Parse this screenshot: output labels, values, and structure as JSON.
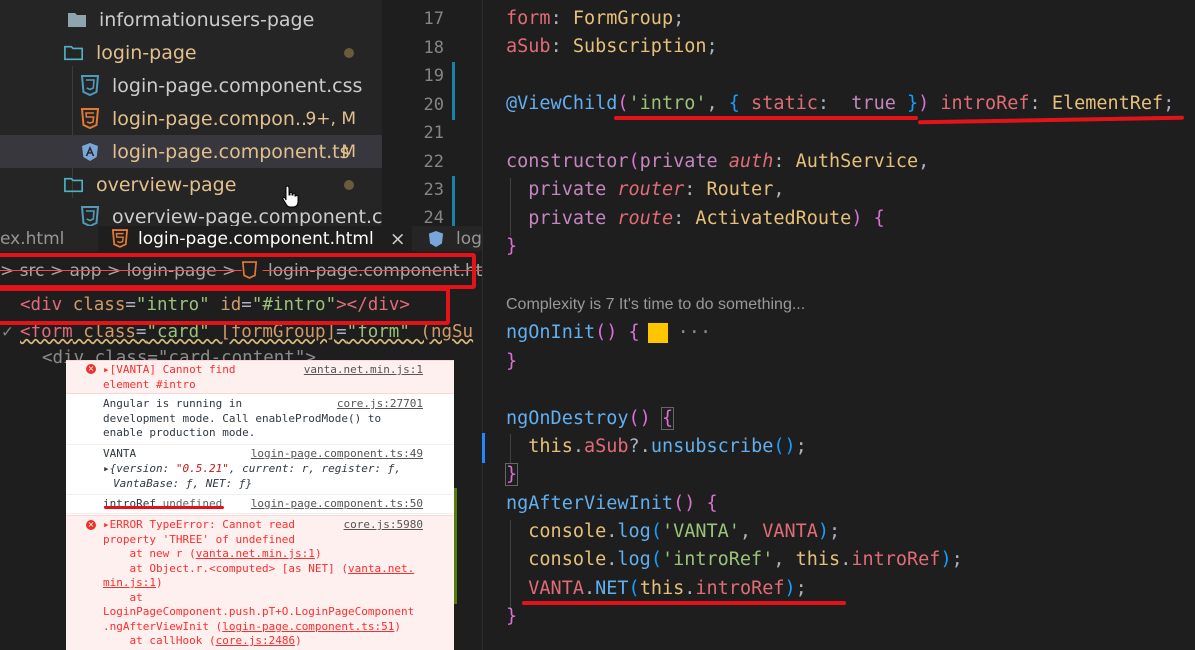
{
  "explorer": {
    "items": [
      {
        "label": "informationusers-page",
        "type": "folder-closed",
        "status": ""
      },
      {
        "label": "login-page",
        "type": "folder-open",
        "status": "dot"
      },
      {
        "label": "login-page.component.css",
        "type": "css",
        "status": ""
      },
      {
        "label": "login-page.compon...",
        "type": "html",
        "status": "9+, M"
      },
      {
        "label": "login-page.component.ts",
        "type": "ts",
        "status": "M"
      },
      {
        "label": "overview-page",
        "type": "folder-open",
        "status": "dot"
      },
      {
        "label": "overview-page.component.css",
        "type": "css",
        "status": ""
      }
    ]
  },
  "tabs": [
    {
      "label": "ex.html"
    },
    {
      "label": "login-page.component.html",
      "close": "×"
    },
    {
      "label": "log"
    }
  ],
  "html_editor": {
    "breadcrumb": "> src > app > login-page > ",
    "breadcrumb_file": "login-page.component.html",
    "lines": [
      {
        "tag_open": "<div",
        "a1": " class",
        "eq1": "=",
        "v1": "\"intro\"",
        "a2": " id",
        "eq2": "=",
        "v2": "\"#intro\"",
        "close": "></div>"
      },
      {
        "tag_open": "<form",
        "a1": " class",
        "eq1": "=",
        "v1": "\"card\"",
        "a2": " [formGroup]",
        "eq2": "=",
        "v2": "\"form\"",
        "rest": " (ngSu"
      },
      {
        "text": "<div class=\"card-content\">"
      }
    ]
  },
  "console": {
    "messages": [
      {
        "level": "error",
        "text": "▸[VANTA] Cannot find\nelement #intro",
        "source": "vanta.net.min.js:1"
      },
      {
        "level": "info",
        "text": "Angular is running in\ndevelopment mode. Call enableProdMode() to\nenable production mode.",
        "source": "core.js:27701"
      },
      {
        "level": "log",
        "text": "VANTA",
        "source": "login-page.component.ts:49",
        "obj_prefix": "▸{version: ",
        "obj_version": "\"0.5.21\"",
        "obj_rest": ", current: r, register: ƒ,",
        "obj_line2": "VantaBase: ƒ, NET: ƒ}"
      },
      {
        "level": "log",
        "text": "introRef",
        "value": "undefined",
        "source": "login-page.component.ts:50"
      },
      {
        "level": "error",
        "text": "▸ERROR TypeError: Cannot read\nproperty 'THREE' of undefined\n    at new r (",
        "source": "core.js:5980",
        "trace": [
          {
            "pre": "    at new r (",
            "link": "vanta.net.min.js:1",
            "post": ")"
          },
          {
            "pre": "    at Object.r.<computed> [as NET] (",
            "link": "vanta.net.",
            "post": ""
          },
          {
            "pre": "",
            "link": "min.js:1",
            "post": ")"
          },
          {
            "pre": "    at",
            "link": "",
            "post": ""
          },
          {
            "pre": "LoginPageComponent.push.pT+O.LoginPageComponent",
            "link": "",
            "post": ""
          },
          {
            "pre": ".ngAfterViewInit (",
            "link": "login-page.component.ts:51",
            "post": ")"
          },
          {
            "pre": "    at callHook (",
            "link": "core.js:2486",
            "post": ")"
          }
        ],
        "head1": "▸ERROR TypeError: Cannot read",
        "head2": "property 'THREE' of undefined"
      }
    ]
  },
  "code_editor": {
    "line_numbers": [
      "17",
      "18",
      "19",
      "20",
      "21",
      "22",
      "23",
      "24"
    ],
    "codelens": "Complexity is 7 It's time to do something...",
    "ellipsis": "···",
    "tokens": {
      "form": "form",
      "colon": ": ",
      "FormGroup": "FormGroup",
      "semi": ";",
      "aSub": "aSub",
      "Subscription": "Subscription",
      "at_viewchild": "@ViewChild",
      "lp": "(",
      "intro_str": "'intro'",
      "comma": ", ",
      "lb": "{",
      "static": " static",
      "true": " true ",
      "rb": "}",
      "rp": ")",
      "introRef": " introRef",
      "ElementRef": "ElementRef",
      "constructor": "constructor",
      "private": "private",
      "auth": "auth",
      "AuthService": "AuthService",
      "router": "router",
      "Router": "Router",
      "route": "route",
      "ActivatedRoute": "ActivatedRoute",
      "ngOnInit": "ngOnInit",
      "ngOnDestroy": "ngOnDestroy",
      "this": "this",
      "dot": ".",
      "unsubscribe": "unsubscribe",
      "qdot": "?.",
      "ngAfterViewInit": "ngAfterViewInit",
      "console": "console",
      "log": "log",
      "vanta_str": "'VANTA'",
      "VANTA": "VANTA",
      "introRef_str": "'introRef'",
      "introRef_plain": "introRef",
      "NET": "NET"
    }
  },
  "colors": {
    "annotation_red": "#e4131a",
    "git_modified": "#1b81a8",
    "lightbulb": "#ffc600"
  }
}
